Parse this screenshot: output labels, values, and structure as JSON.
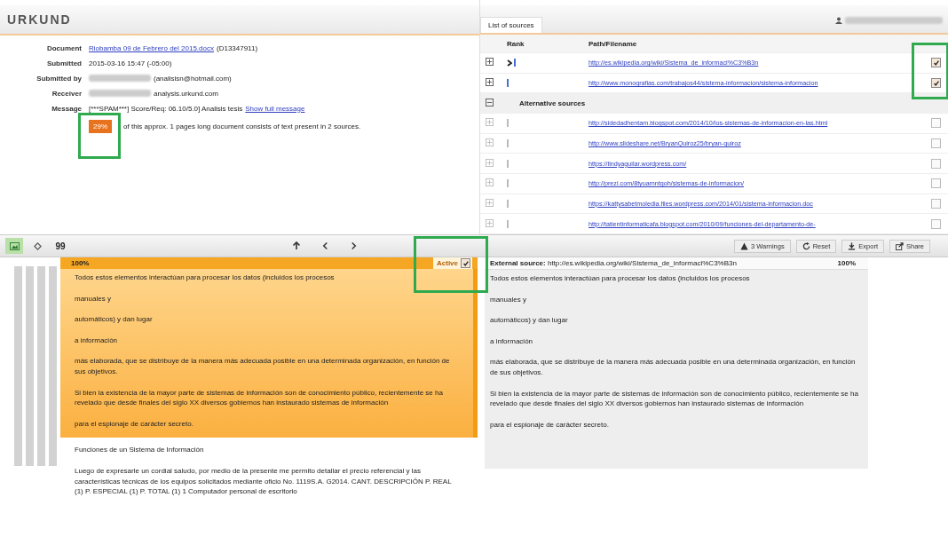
{
  "logo": "URKUND",
  "details": [
    {
      "label": "Document",
      "link": "Riobamba 09 de Febrero del 2015.docx",
      "text": "(D13347911)"
    },
    {
      "label": "Submitted",
      "text": "2015-03-16 15:47 (-05:00)"
    },
    {
      "label": "Submitted by",
      "blurred": true,
      "text": "(analisisn@hotmail.com)"
    },
    {
      "label": "Receiver",
      "blurred": true,
      "text": "analysis.urkund.com"
    },
    {
      "label": "Message",
      "text": "[***SPAM***] Score/Req: 06.10/5.0] Analisis tesis",
      "link_after": "Show full message"
    }
  ],
  "score": {
    "badge": "29%",
    "text": "of this approx. 1 pages long document consists of text present in 2 sources."
  },
  "sources_tab": {
    "label": "List of sources",
    "selected": true
  },
  "columns": [
    "Rank",
    "Path/Filename"
  ],
  "sources": [
    {
      "url": "http://es.wikipedia.org/wiki/Sistema_de_informaci%C3%B3n",
      "checked": true,
      "current": true
    },
    {
      "url": "http://www.monografias.com/trabajos44/sistema-informacion/sistema-informacion",
      "checked": true,
      "current": false
    }
  ],
  "alternative": {
    "label": "Alternative sources",
    "expanded": true,
    "items": [
      {
        "url": "http://sidedadhentam.blogspot.com/2014/10/los-sistemas-de-informacion-en-las.html",
        "checked": false
      },
      {
        "url": "http://www.slideshare.net/BryanQuiroz25/bryan-quiroz",
        "checked": false
      },
      {
        "url": "https://lindyaguilar.wordpress.com/",
        "checked": false
      },
      {
        "url": "http://prezi.com/8tyuamntgoh/sistemas-de-informacion/",
        "checked": false
      },
      {
        "url": "https://kattysabetmoledia.files.wordpress.com/2014/01/sistema-informacion.doc",
        "checked": false
      },
      {
        "url": "http://tatientinformaticafa.blogspot.com/2010/09/funciones-del-departamento-de-",
        "checked": false
      }
    ]
  },
  "toolbar": {
    "quote": "99",
    "actions": [
      {
        "kind": "warning",
        "label": "3 Warnings"
      },
      {
        "kind": "reset",
        "label": "Reset"
      },
      {
        "kind": "export",
        "label": "Export"
      },
      {
        "kind": "share",
        "label": "Share"
      }
    ]
  },
  "document_pane": {
    "percent": "100%",
    "active_label": "Active",
    "active": true,
    "paragraphs": [
      "Todos estos elementos interactúan para procesar los datos (incluidos los procesos",
      "manuales y",
      "automáticos) y dan lugar",
      "a información",
      "más elaborada, que se distribuye de la manera más adecuada posible en una determinada organización, en función de sus objetivos.",
      "Si bien la existencia de la mayor parte de sistemas de información son de conocimiento público, recientemente se ha revelado que desde finales del siglo XX diversos gobiernos han instaurado sistemas de información",
      "para el espionaje de carácter secreto."
    ],
    "after": [
      "Funciones de un Sistema de Información",
      "Luego de expresarle un cordial saludo, por medio de la presente me permito detallar el precio referencial y las características técnicas de los equipos solicitados mediante oficio No. 1119S.A. G2014. CANT. DESCRIPCIÓN P. REAL (1) P. ESPECIAL (1) P. TOTAL (1) 1 Computador personal de escritorio"
    ]
  },
  "source_pane": {
    "label": "External source:",
    "url": "http://es.wikipedia.org/wiki/Sistema_de_informaci%C3%B3n",
    "percent": "100%",
    "paragraphs": [
      "Todos estos elementos interactúan para procesar los datos (incluidos los procesos",
      "manuales y",
      "automáticos) y dan lugar",
      "a información",
      "más elaborada, que se distribuye de la manera más adecuada posible en una determinada organización, en función de sus objetivos.",
      "Si bien la existencia de la mayor parte de sistemas de información son de conocimiento público, recientemente se ha revelado que desde finales del siglo XX diversos gobiernos han instaurado sistemas de información",
      "para el espionaje de carácter secreto."
    ]
  }
}
